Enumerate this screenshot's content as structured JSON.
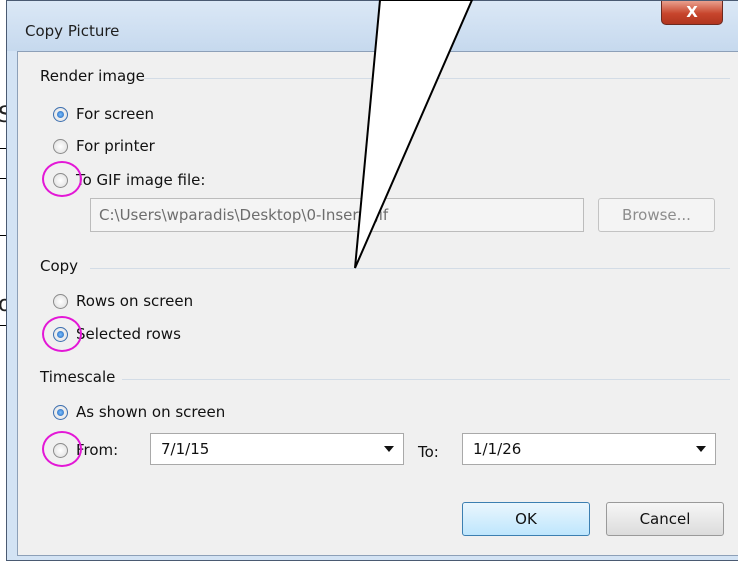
{
  "window": {
    "title": "Copy Picture",
    "close_label": "X"
  },
  "render_image": {
    "group_label": "Render image",
    "options": [
      {
        "label": "For screen",
        "checked": true
      },
      {
        "label": "For printer",
        "checked": false
      },
      {
        "label": "To GIF image file:",
        "checked": false
      }
    ],
    "file_path": "C:\\Users\\wparadis\\Desktop\\0-Insert.gif",
    "browse_label": "Browse..."
  },
  "copy": {
    "group_label": "Copy",
    "options": [
      {
        "label": "Rows on screen",
        "checked": false
      },
      {
        "label": "Selected rows",
        "checked": true
      }
    ]
  },
  "timescale": {
    "group_label": "Timescale",
    "options": [
      {
        "label": "As shown on screen",
        "checked": true
      },
      {
        "label": "From:",
        "checked": false
      }
    ],
    "from_value": "7/1/15",
    "to_label": "To:",
    "to_value": "1/1/26"
  },
  "buttons": {
    "ok": "OK",
    "cancel": "Cancel"
  },
  "background": {
    "fragment_1": "S",
    "fragment_2": "o"
  },
  "colors": {
    "highlight_ring": "#e317d6",
    "close_button": "#c7452c",
    "selected_radio": "#1d5fb5"
  }
}
